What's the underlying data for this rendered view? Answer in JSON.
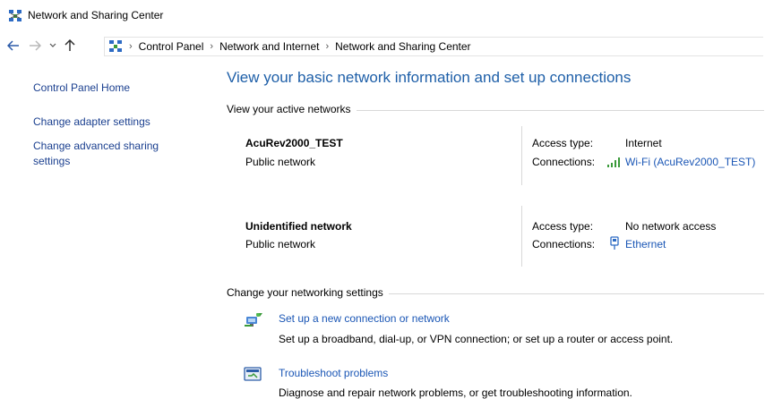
{
  "window": {
    "title": "Network and Sharing Center"
  },
  "address_bar": {
    "crumbs": [
      "Control Panel",
      "Network and Internet",
      "Network and Sharing Center"
    ]
  },
  "left_nav": {
    "home": "Control Panel Home",
    "adapter": "Change adapter settings",
    "advanced_line1": "Change advanced sharing",
    "advanced_line2": "settings"
  },
  "main": {
    "heading": "View your basic network information and set up connections",
    "active_networks_label": "View your active networks",
    "networks": [
      {
        "name": "AcuRev2000_TEST",
        "type": "Public network",
        "access_label": "Access type:",
        "access_value": "Internet",
        "connections_label": "Connections:",
        "connection": "Wi-Fi (AcuRev2000_TEST)",
        "connection_icon": "wifi-signal-icon"
      },
      {
        "name": "Unidentified network",
        "type": "Public network",
        "access_label": "Access type:",
        "access_value": "No network access",
        "connections_label": "Connections:",
        "connection": "Ethernet",
        "connection_icon": "ethernet-icon"
      }
    ],
    "change_settings_label": "Change your networking settings",
    "tasks": [
      {
        "link": "Set up a new connection or network",
        "desc": "Set up a broadband, dial-up, or VPN connection; or set up a router or access point.",
        "icon": "new-connection-icon"
      },
      {
        "link": "Troubleshoot problems",
        "desc": "Diagnose and repair network problems, or get troubleshooting information.",
        "icon": "troubleshoot-icon"
      }
    ]
  },
  "colors": {
    "link": "#1a56b5",
    "heading": "#1e5fa8",
    "nav_link": "#1a3f8f"
  }
}
